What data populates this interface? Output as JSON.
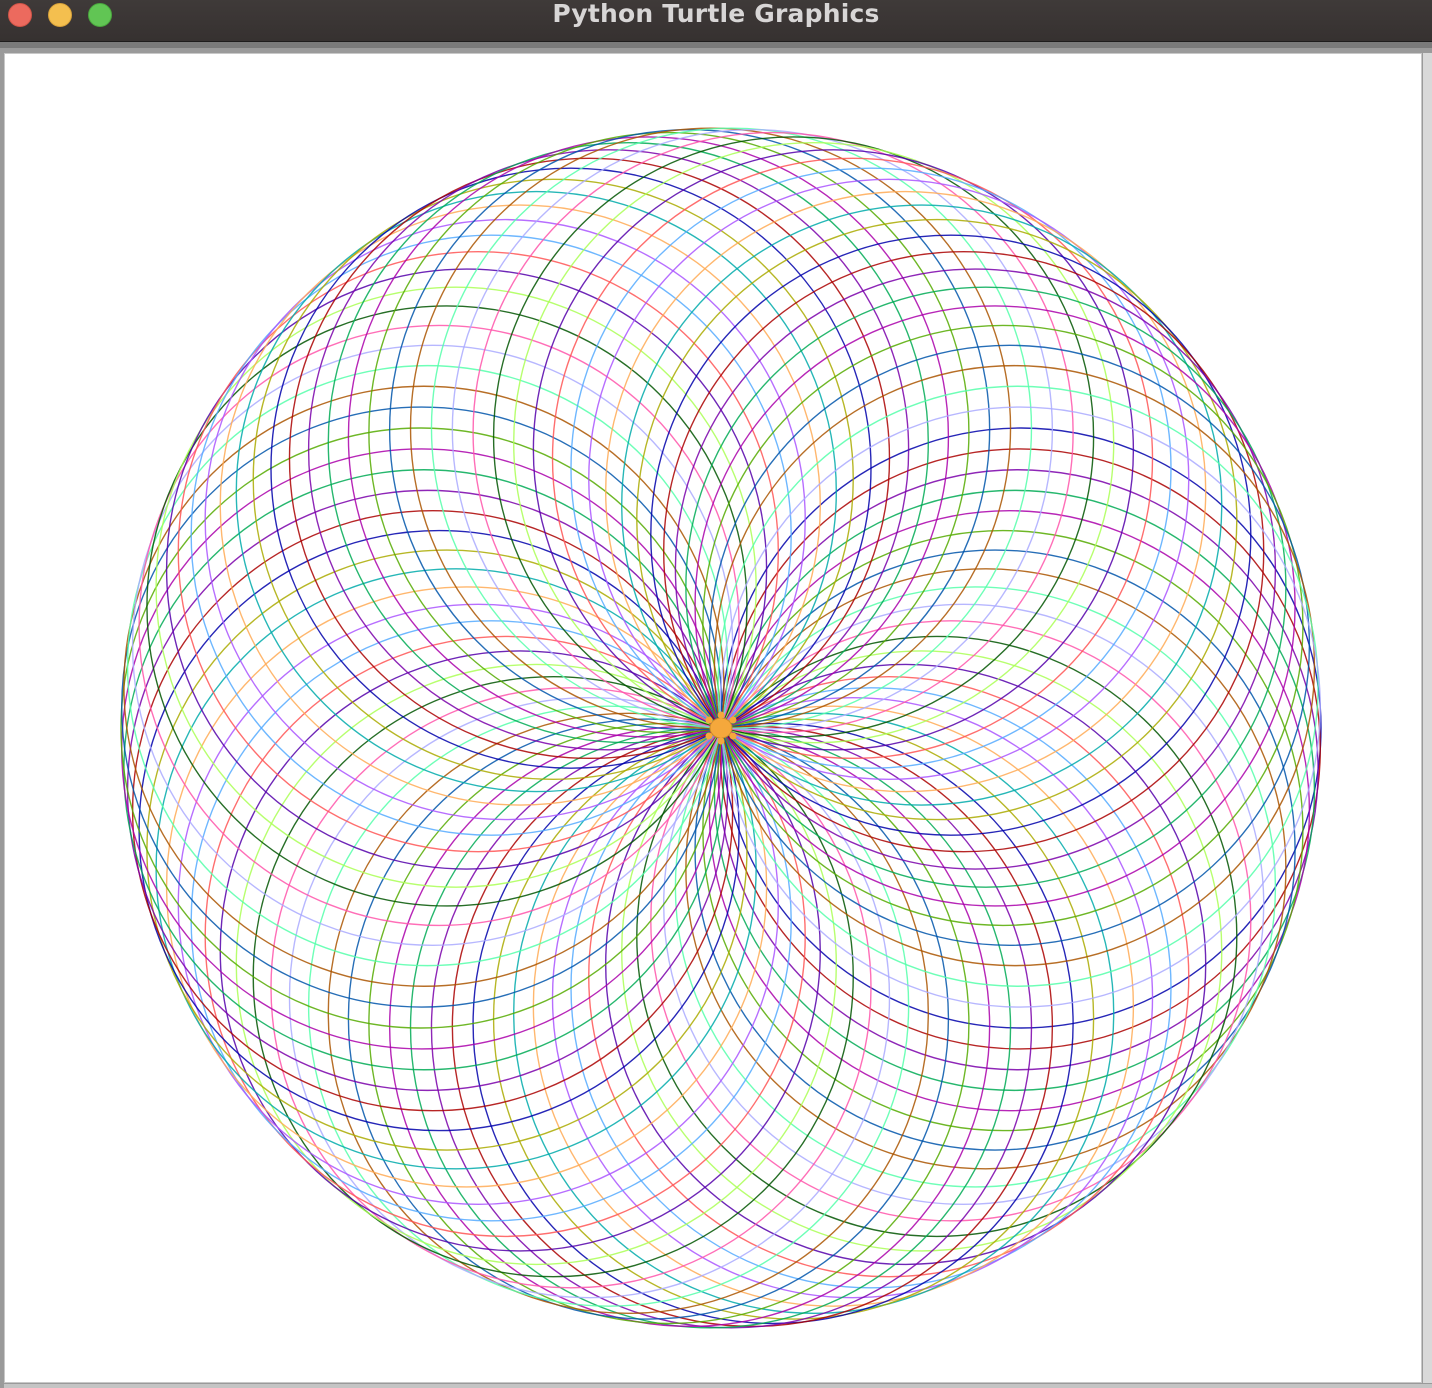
{
  "window": {
    "title": "Python Turtle Graphics",
    "controls": {
      "close_color": "#ec6a5e",
      "minimize_color": "#f4bf4f",
      "maximize_color": "#61c554"
    }
  },
  "canvas": {
    "background": "#ffffff",
    "drawing": "spirograph-circles",
    "circle_count": 90,
    "palette": [
      "#0000aa",
      "#aa0000",
      "#7a00aa",
      "#00aa55",
      "#aa00aa",
      "#55aa00",
      "#0055aa",
      "#aa5500",
      "#55ffaa",
      "#aaaaff",
      "#ff55aa",
      "#005500",
      "#aaff55",
      "#5500aa",
      "#ff5555",
      "#55aaff",
      "#aa55ff",
      "#ffaa55",
      "#00aaaa",
      "#aaaa00"
    ],
    "turtle_color": "#f5a83c",
    "turtle_icon": "turtle-icon"
  }
}
